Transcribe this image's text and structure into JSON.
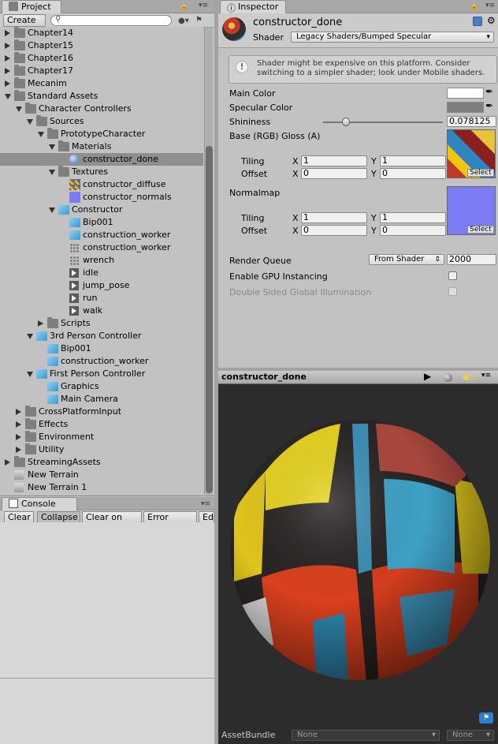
{
  "project": {
    "tab_label": "Project",
    "create_label": "Create",
    "search_placeholder": "",
    "tree": [
      {
        "label": "Chapter14",
        "icon": "folder-icon"
      },
      {
        "label": "Chapter15",
        "icon": "folder-icon"
      },
      {
        "label": "Chapter16",
        "icon": "folder-icon"
      },
      {
        "label": "Chapter17",
        "icon": "folder-icon"
      },
      {
        "label": "Mecanim",
        "icon": "folder-icon"
      },
      {
        "label": "Standard Assets",
        "icon": "folder-icon"
      },
      {
        "label": "Character Controllers",
        "icon": "folder-icon"
      },
      {
        "label": "Sources",
        "icon": "folder-icon"
      },
      {
        "label": "PrototypeCharacter",
        "icon": "folder-icon"
      },
      {
        "label": "Materials",
        "icon": "folder-icon"
      },
      {
        "label": "constructor_done",
        "icon": "material-icon"
      },
      {
        "label": "Textures",
        "icon": "folder-icon"
      },
      {
        "label": "constructor_diffuse",
        "icon": "texture-icon"
      },
      {
        "label": "constructor_normals",
        "icon": "normal-map-icon"
      },
      {
        "label": "Constructor",
        "icon": "model-prefab-icon"
      },
      {
        "label": "Bip001",
        "icon": "cube-icon"
      },
      {
        "label": "construction_worker",
        "icon": "cube-icon"
      },
      {
        "label": "construction_worker",
        "icon": "mesh-icon"
      },
      {
        "label": "wrench",
        "icon": "mesh-icon"
      },
      {
        "label": "idle",
        "icon": "animation-clip-icon"
      },
      {
        "label": "jump_pose",
        "icon": "animation-clip-icon"
      },
      {
        "label": "run",
        "icon": "animation-clip-icon"
      },
      {
        "label": "walk",
        "icon": "animation-clip-icon"
      },
      {
        "label": "Scripts",
        "icon": "folder-icon"
      },
      {
        "label": "3rd Person Controller",
        "icon": "cube-icon"
      },
      {
        "label": "Bip001",
        "icon": "cube-icon"
      },
      {
        "label": "construction_worker",
        "icon": "cube-icon"
      },
      {
        "label": "First Person Controller",
        "icon": "cube-icon"
      },
      {
        "label": "Graphics",
        "icon": "cube-icon"
      },
      {
        "label": "Main Camera",
        "icon": "cube-icon"
      },
      {
        "label": "CrossPlatformInput",
        "icon": "folder-icon"
      },
      {
        "label": "Effects",
        "icon": "folder-icon"
      },
      {
        "label": "Environment",
        "icon": "folder-icon"
      },
      {
        "label": "Utility",
        "icon": "folder-icon"
      },
      {
        "label": "StreamingAssets",
        "icon": "folder-icon"
      },
      {
        "label": "New Terrain",
        "icon": "terrain-icon"
      },
      {
        "label": "New Terrain 1",
        "icon": "terrain-icon"
      }
    ]
  },
  "console": {
    "tab_label": "Console",
    "buttons": [
      "Clear",
      "Collapse",
      "Clear on Play",
      "Error Pause",
      "Edi"
    ]
  },
  "inspector": {
    "tab_label": "Inspector",
    "material_name": "constructor_done",
    "shader_label": "Shader",
    "shader_value": "Legacy Shaders/Bumped Specular",
    "warning": "Shader might be expensive on this platform. Consider switching to a simpler shader; look under Mobile shaders.",
    "main_color_label": "Main Color",
    "specular_color_label": "Specular Color",
    "shininess_label": "Shininess",
    "shininess_value": "0.078125",
    "shininess_fraction": 0.078125,
    "base_label": "Base (RGB) Gloss (A)",
    "normalmap_label": "Normalmap",
    "tiling_label": "Tiling",
    "offset_label": "Offset",
    "x_label": "X",
    "y_label": "Y",
    "base_tiling_x": "1",
    "base_tiling_y": "1",
    "base_offset_x": "0",
    "base_offset_y": "0",
    "normal_tiling_x": "1",
    "normal_tiling_y": "1",
    "normal_offset_x": "0",
    "normal_offset_y": "0",
    "select_label": "Select",
    "render_queue_label": "Render Queue",
    "render_queue_mode": "From Shader",
    "render_queue_value": "2000",
    "gpu_instancing_label": "Enable GPU Instancing",
    "double_sided_label": "Double Sided Global Illumination"
  },
  "preview": {
    "title": "constructor_done",
    "assetbundle_label": "AssetBundle",
    "assetbundle_value": "None",
    "variant_value": "None"
  },
  "colors": {
    "main_color": "#ffffff",
    "specular_color": "#7f7f7f",
    "selection": "#8f8f8f",
    "accent": "#2f7fd0"
  }
}
